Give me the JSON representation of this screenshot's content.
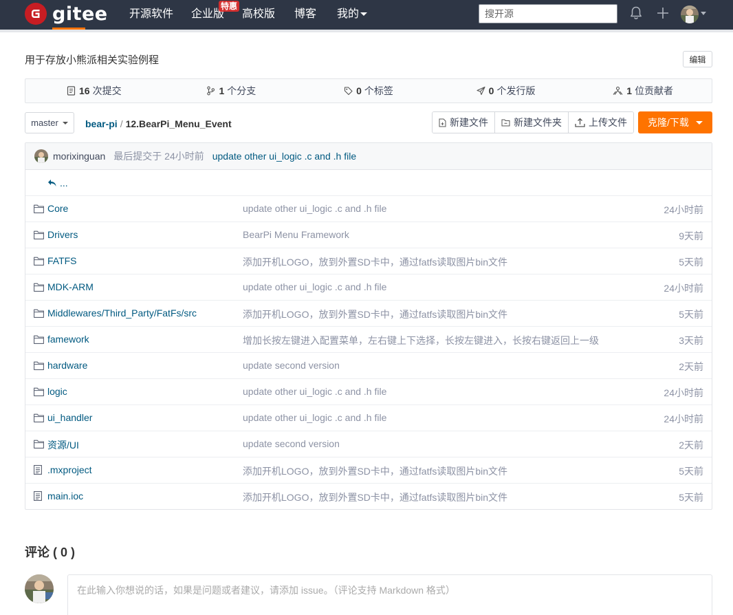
{
  "nav": {
    "logo_text": "gitee",
    "items": [
      "开源软件",
      "企业版",
      "高校版",
      "博客",
      "我的"
    ],
    "badge": "特惠",
    "search_placeholder": "搜开源"
  },
  "repo": {
    "description": "用于存放小熊派相关实验例程",
    "edit_label": "编辑"
  },
  "stats": {
    "commits": {
      "count": "16",
      "label": "次提交"
    },
    "branches": {
      "count": "1",
      "label": "个分支"
    },
    "tags": {
      "count": "0",
      "label": "个标签"
    },
    "releases": {
      "count": "0",
      "label": "个发行版"
    },
    "contributors": {
      "count": "1",
      "label": "位贡献者"
    }
  },
  "toolbar": {
    "branch": "master",
    "path_repo": "bear-pi",
    "path_sep": "/",
    "path_current": "12.BearPi_Menu_Event",
    "new_file": "新建文件",
    "new_folder": "新建文件夹",
    "upload": "上传文件",
    "clone": "克隆/下载"
  },
  "latest_commit": {
    "author": "morixinguan",
    "time": "最后提交于 24小时前",
    "message": "update other ui_logic .c and .h file"
  },
  "up_label": "...",
  "files": [
    {
      "name": "Core",
      "type": "folder",
      "message": "update other ui_logic .c and .h file",
      "time": "24小时前"
    },
    {
      "name": "Drivers",
      "type": "folder",
      "message": "BearPi Menu Framework",
      "time": "9天前"
    },
    {
      "name": "FATFS",
      "type": "folder",
      "message": "添加开机LOGO，放到外置SD卡中，通过fatfs读取图片bin文件",
      "time": "5天前"
    },
    {
      "name": "MDK-ARM",
      "type": "folder",
      "message": "update other ui_logic .c and .h file",
      "time": "24小时前"
    },
    {
      "name": "Middlewares/Third_Party/FatFs/src",
      "type": "folder",
      "message": "添加开机LOGO，放到外置SD卡中，通过fatfs读取图片bin文件",
      "time": "5天前"
    },
    {
      "name": "famework",
      "type": "folder",
      "message": "增加长按左键进入配置菜单，左右键上下选择，长按左键进入，长按右键返回上一级",
      "time": "3天前"
    },
    {
      "name": "hardware",
      "type": "folder",
      "message": "update second version",
      "time": "2天前"
    },
    {
      "name": "logic",
      "type": "folder",
      "message": "update other ui_logic .c and .h file",
      "time": "24小时前"
    },
    {
      "name": "ui_handler",
      "type": "folder",
      "message": "update other ui_logic .c and .h file",
      "time": "24小时前"
    },
    {
      "name": "资源/UI",
      "type": "folder",
      "message": "update second version",
      "time": "2天前"
    },
    {
      "name": ".mxproject",
      "type": "file",
      "message": "添加开机LOGO，放到外置SD卡中，通过fatfs读取图片bin文件",
      "time": "5天前"
    },
    {
      "name": "main.ioc",
      "type": "file",
      "message": "添加开机LOGO，放到外置SD卡中，通过fatfs读取图片bin文件",
      "time": "5天前"
    }
  ],
  "comments": {
    "title": "评论 ( 0 )",
    "placeholder": "在此输入你想说的话，如果是问题或者建议，请添加 issue。（评论支持 Markdown 格式）"
  },
  "colors": {
    "nav_bg": "#2e3645",
    "brand_red": "#c71d23",
    "accent_orange": "#fe7300",
    "link": "#005980",
    "muted": "#8c92a4"
  }
}
